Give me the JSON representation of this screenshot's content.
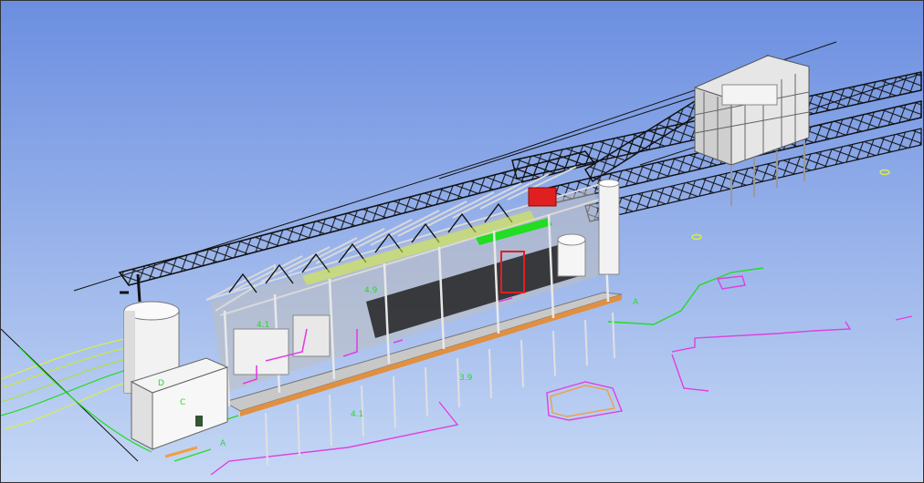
{
  "viewport": {
    "background_top": "#6b8ee0",
    "background_bottom": "#c6d8f5"
  },
  "labels": {
    "gridline_a_lower": "A",
    "gridline_a_upper": "A",
    "elev_lower": "4.1",
    "elev_mid": "3.9",
    "elev_upper": "4.1",
    "elev_roof": "4.9",
    "building_d": "D",
    "building_c": "C"
  },
  "colors": {
    "structure": "#111111",
    "steel_light": "#d0d0d0",
    "survey_green": "#22dd22",
    "survey_yellow": "#d8f040",
    "survey_magenta": "#e040e0",
    "survey_orange": "#f0a040",
    "equipment_red": "#e02020"
  }
}
